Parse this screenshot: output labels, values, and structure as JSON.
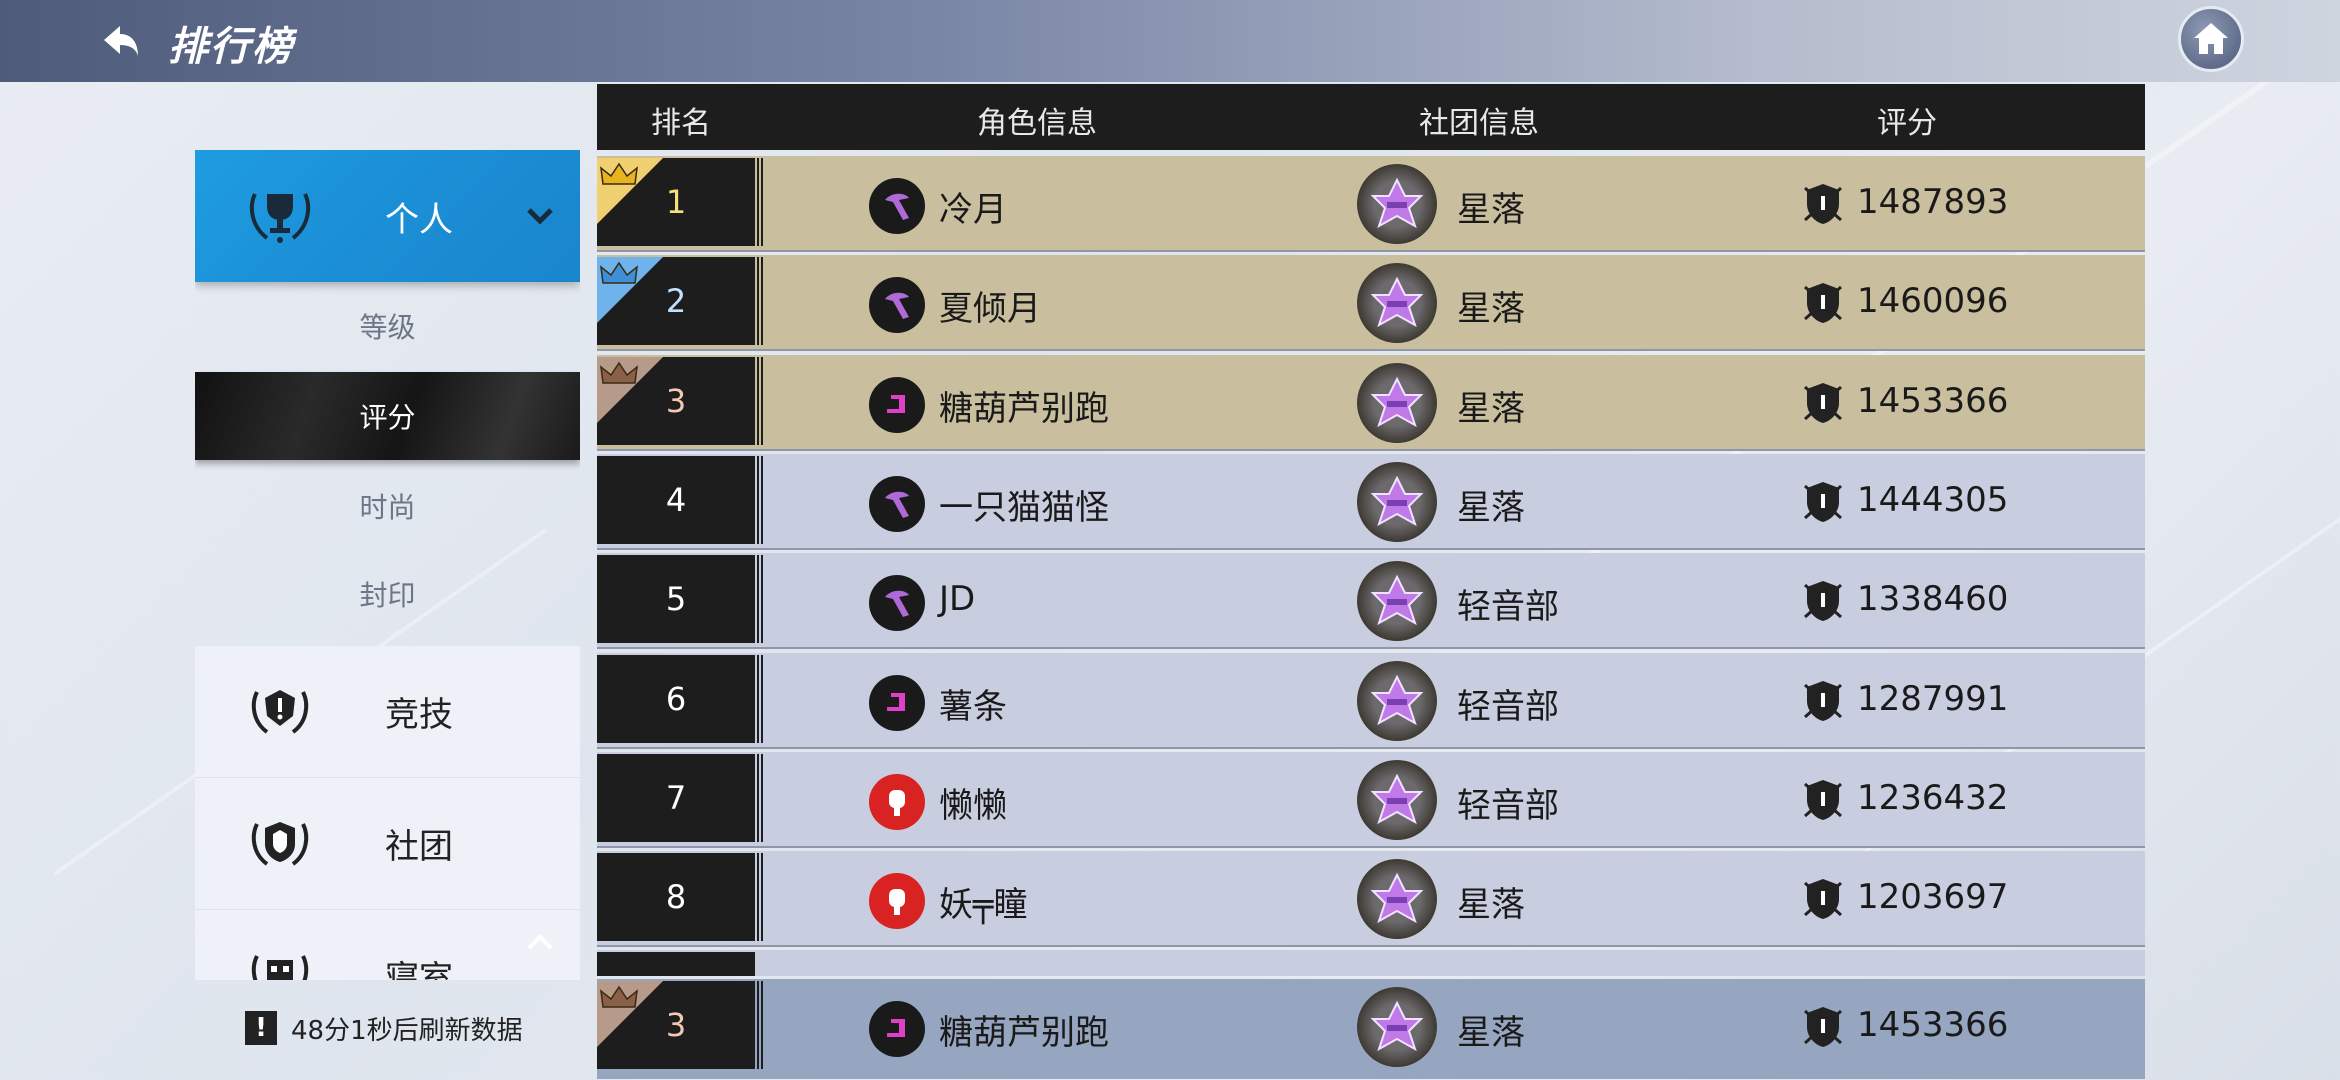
{
  "header": {
    "title": "排行榜",
    "back_icon": "back-arrow-icon",
    "home_icon": "home-icon"
  },
  "sidebar": {
    "categories": [
      {
        "label": "个人",
        "icon": "trophy-icon",
        "active": true
      },
      {
        "label": "竞技",
        "icon": "pvp-emblem-icon",
        "active": false
      },
      {
        "label": "社团",
        "icon": "club-shield-icon",
        "active": false
      },
      {
        "label": "寝室",
        "icon": "dorm-icon",
        "active": false
      }
    ],
    "personal_subtabs": [
      {
        "label": "等级",
        "active": false
      },
      {
        "label": "评分",
        "active": true
      },
      {
        "label": "时尚",
        "active": false
      },
      {
        "label": "封印",
        "active": false
      }
    ]
  },
  "refresh_notice": "48分1秒后刷新数据",
  "table": {
    "columns": [
      "排名",
      "角色信息",
      "社团信息",
      "评分"
    ],
    "rows": [
      {
        "rank": "1",
        "name": "冷月",
        "club": "星落",
        "score": "1487893",
        "class_icon": "scythe-class-icon",
        "crown": "gold"
      },
      {
        "rank": "2",
        "name": "夏倾月",
        "club": "星落",
        "score": "1460096",
        "class_icon": "scythe-class-icon",
        "crown": "blue"
      },
      {
        "rank": "3",
        "name": "糖葫芦别跑",
        "club": "星落",
        "score": "1453366",
        "class_icon": "pink-class-icon",
        "crown": "bronze"
      },
      {
        "rank": "4",
        "name": "一只猫猫怪",
        "club": "星落",
        "score": "1444305",
        "class_icon": "scythe-class-icon",
        "crown": ""
      },
      {
        "rank": "5",
        "name": "JD",
        "club": "轻音部",
        "score": "1338460",
        "class_icon": "scythe-class-icon",
        "crown": ""
      },
      {
        "rank": "6",
        "name": "薯条",
        "club": "轻音部",
        "score": "1287991",
        "class_icon": "pink-class-icon",
        "crown": ""
      },
      {
        "rank": "7",
        "name": "懒懒",
        "club": "轻音部",
        "score": "1236432",
        "class_icon": "red-fist-class-icon",
        "crown": ""
      },
      {
        "rank": "8",
        "name": "妖╤瞳",
        "club": "星落",
        "score": "1203697",
        "class_icon": "red-fist-class-icon",
        "crown": ""
      }
    ],
    "self_row": {
      "rank": "3",
      "name": "糖葫芦别跑",
      "club": "星落",
      "score": "1453366",
      "class_icon": "pink-class-icon",
      "crown": "bronze"
    }
  },
  "colors": {
    "active_tab": "#1b8fd6",
    "top_row_bg": "#c9bf9e",
    "normal_row_bg": "#c9cde0",
    "self_row_bg": "#96a5c0",
    "header_bg": "#1d1d1d"
  }
}
